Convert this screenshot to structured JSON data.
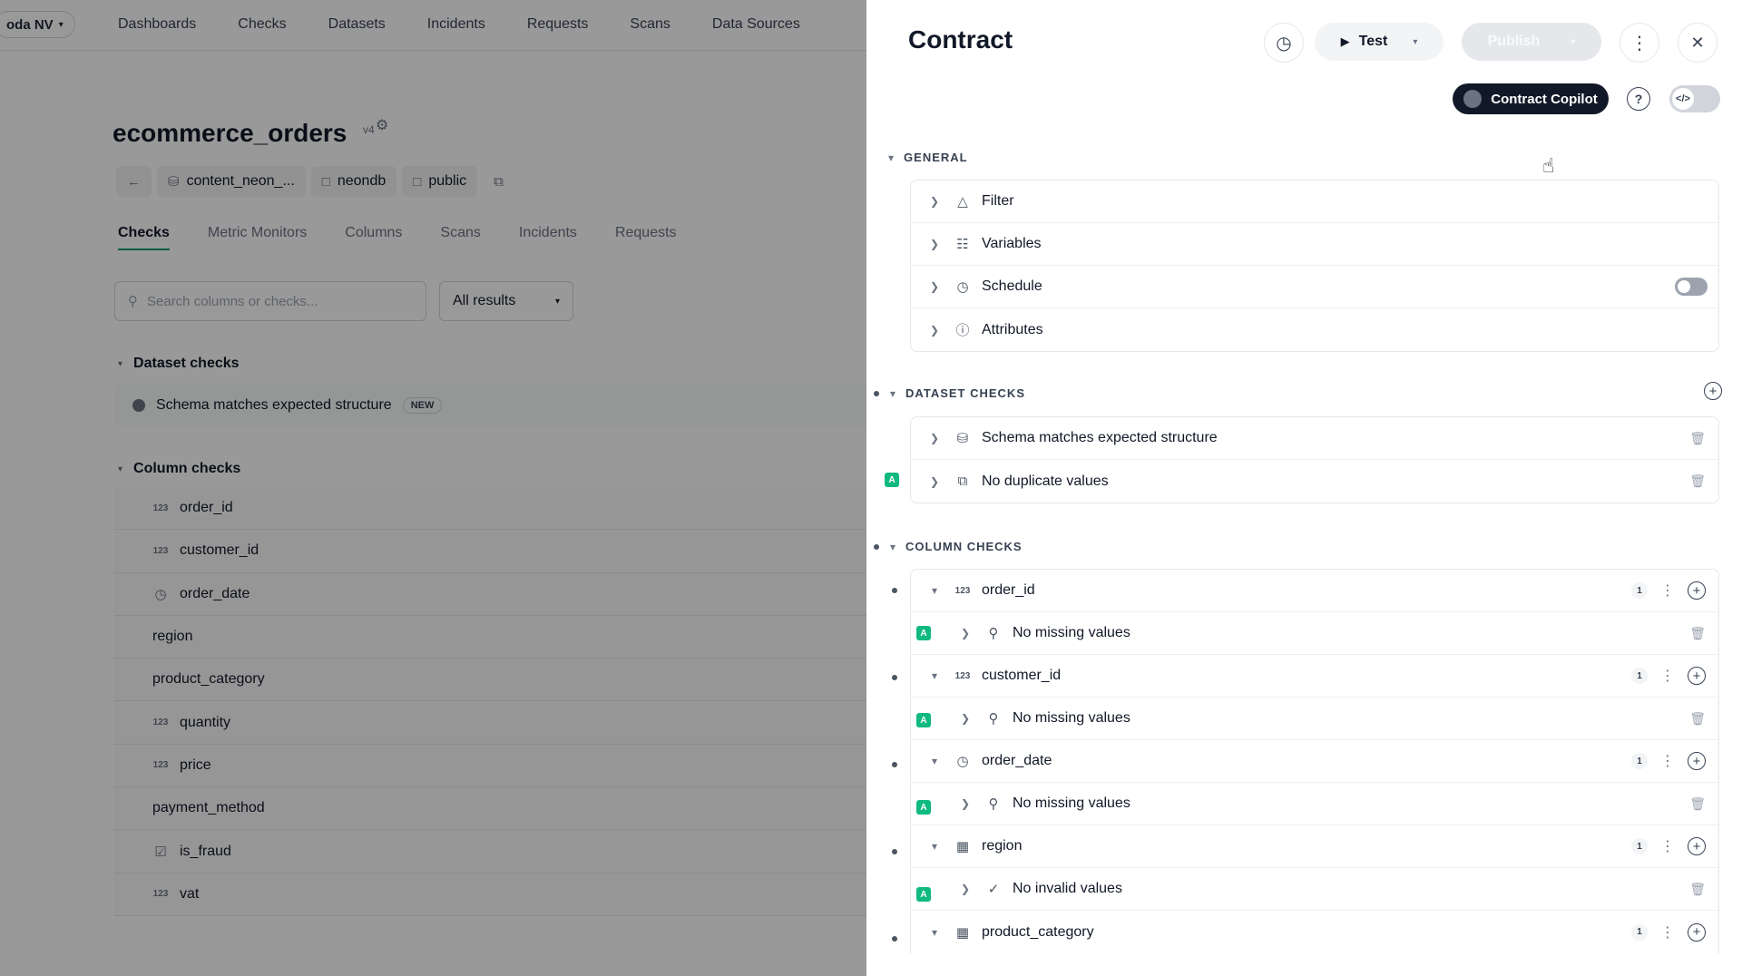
{
  "colors": {
    "accent": "#10b981",
    "active_tab": "#059669",
    "dark": "#111827"
  },
  "topnav": {
    "org": "oda NV",
    "links": [
      "Dashboards",
      "Checks",
      "Datasets",
      "Incidents",
      "Requests",
      "Scans",
      "Data Sources"
    ]
  },
  "dataset": {
    "title": "ecommerce_orders",
    "version": "v4",
    "breadcrumbs": [
      "content_neon_...",
      "neondb",
      "public"
    ]
  },
  "tabs": [
    "Checks",
    "Metric Monitors",
    "Columns",
    "Scans",
    "Incidents",
    "Requests"
  ],
  "search": {
    "placeholder": "Search columns or checks..."
  },
  "results_filter": "All results",
  "left": {
    "dataset_checks_title": "Dataset checks",
    "schema_check": "Schema matches expected structure",
    "new_badge": "NEW",
    "column_checks_title": "Column checks",
    "columns": [
      {
        "name": "order_id",
        "type": "123"
      },
      {
        "name": "customer_id",
        "type": "123"
      },
      {
        "name": "order_date",
        "type": "clock"
      },
      {
        "name": "region",
        "type": ""
      },
      {
        "name": "product_category",
        "type": ""
      },
      {
        "name": "quantity",
        "type": "123"
      },
      {
        "name": "price",
        "type": "123"
      },
      {
        "name": "payment_method",
        "type": ""
      },
      {
        "name": "is_fraud",
        "type": "check"
      },
      {
        "name": "vat",
        "type": "123"
      }
    ]
  },
  "drawer": {
    "title": "Contract",
    "test_label": "Test",
    "publish_label": "Publish",
    "copilot_label": "Contract Copilot",
    "general": {
      "title": "GENERAL",
      "items": [
        "Filter",
        "Variables",
        "Schedule",
        "Attributes"
      ]
    },
    "dataset_checks": {
      "title": "DATASET CHECKS",
      "items": [
        "Schema matches expected structure",
        "No duplicate values"
      ]
    },
    "column_checks": {
      "title": "COLUMN CHECKS",
      "badge": "A",
      "count": "1",
      "columns": [
        {
          "name": "order_id",
          "check": "No missing values"
        },
        {
          "name": "customer_id",
          "check": "No missing values"
        },
        {
          "name": "order_date",
          "check": "No missing values"
        },
        {
          "name": "region",
          "check": "No invalid values"
        },
        {
          "name": "product_category",
          "check": ""
        }
      ]
    }
  }
}
